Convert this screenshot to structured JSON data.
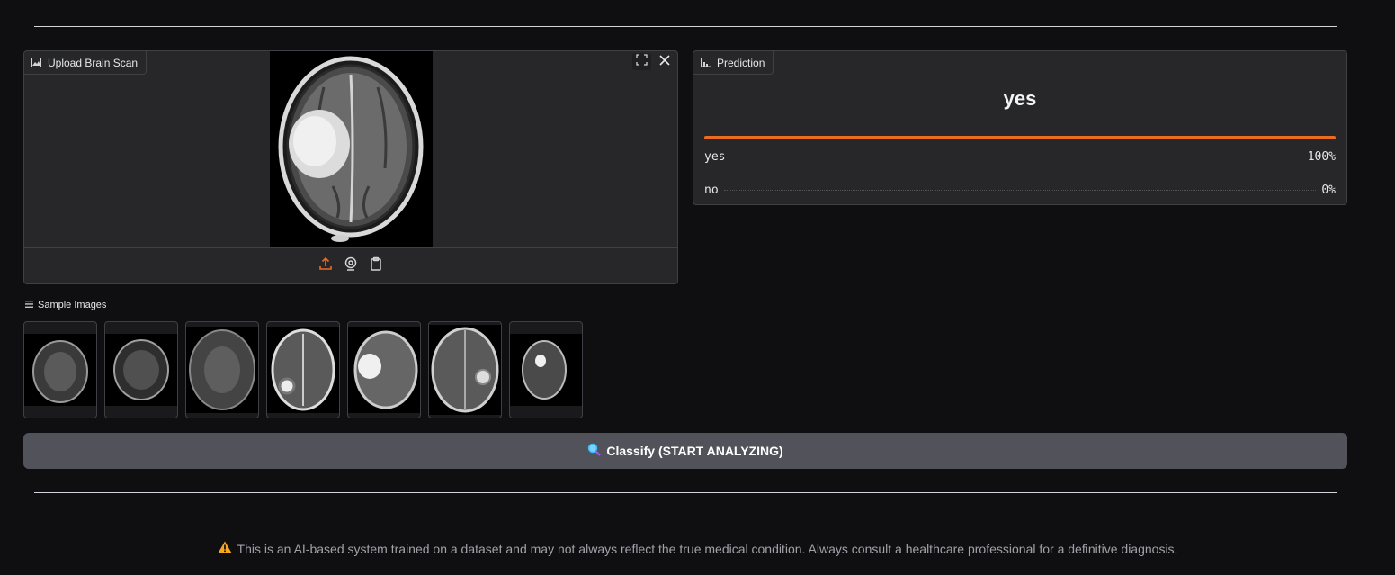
{
  "upload_panel": {
    "label": "Upload Brain Scan"
  },
  "prediction_panel": {
    "label": "Prediction",
    "top_label": "yes",
    "rows": [
      {
        "label": "yes",
        "percent": "100%",
        "confidence": 1.0
      },
      {
        "label": "no",
        "percent": "0%",
        "confidence": 0.0
      }
    ]
  },
  "samples": {
    "label": "Sample Images"
  },
  "classify_button": {
    "label": "Classify (START ANALYZING)"
  },
  "disclaimer": {
    "text": "This is an AI-based system trained on a dataset and may not always reflect the true medical condition. Always consult a healthcare professional for a definitive diagnosis."
  },
  "colors": {
    "accent": "#ea6c20",
    "background": "#0f0f11",
    "panel": "#27272a",
    "button": "#52525b"
  },
  "icons": [
    "image-icon",
    "fullscreen-icon",
    "close-icon",
    "upload-icon",
    "webcam-icon",
    "clipboard-icon",
    "bar-chart-icon",
    "list-icon",
    "magnifier-icon",
    "warning-icon"
  ]
}
